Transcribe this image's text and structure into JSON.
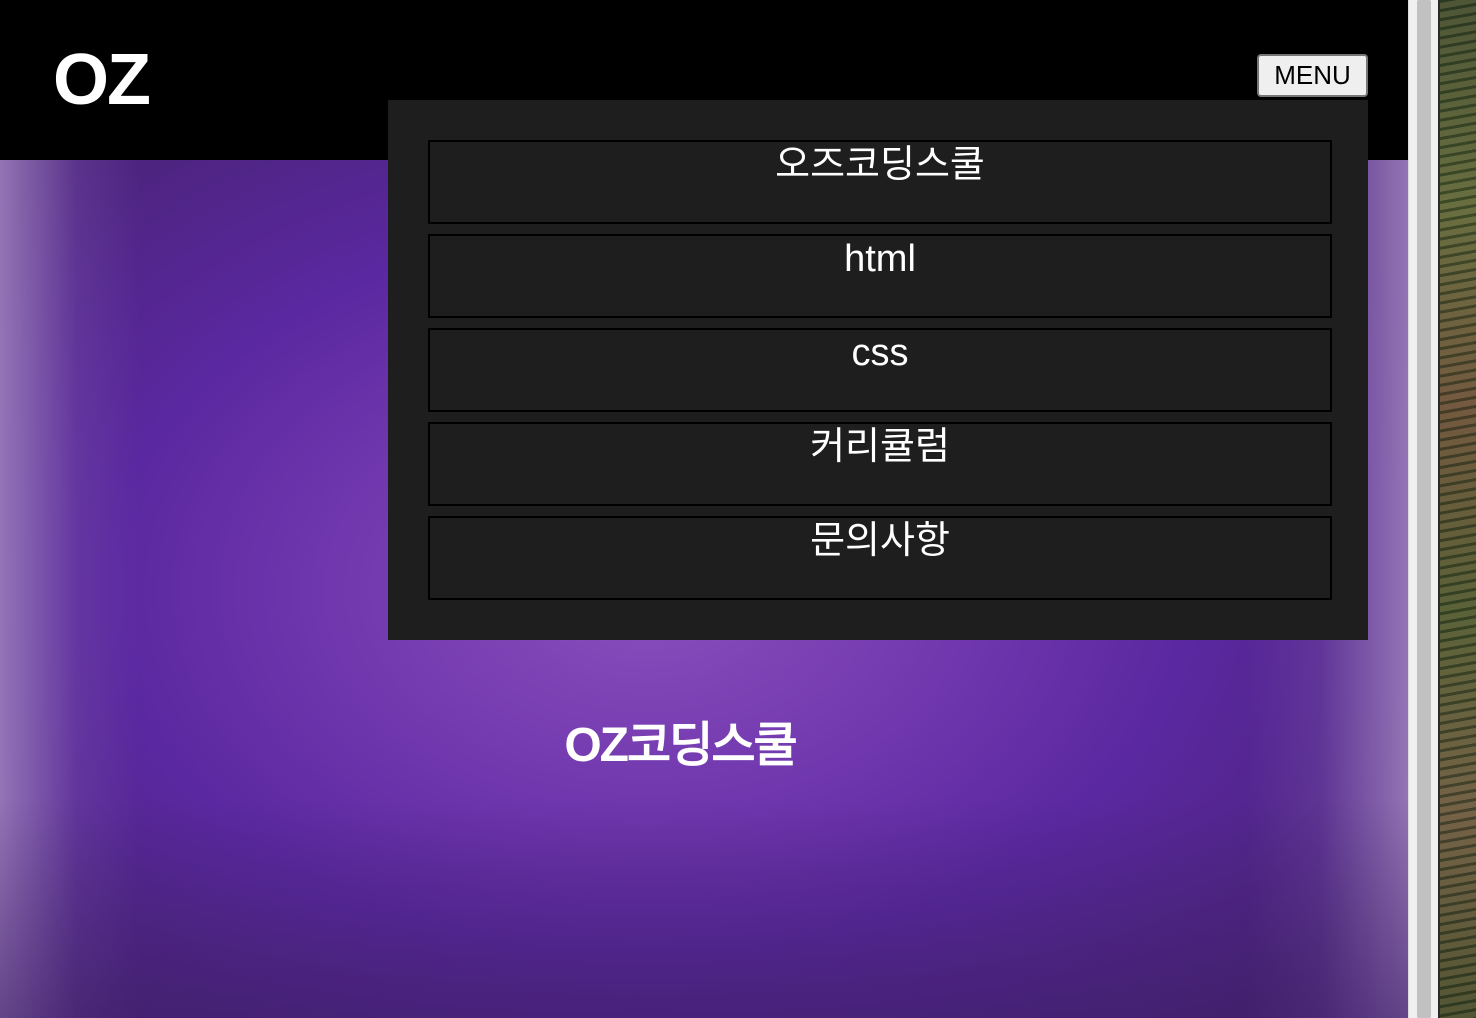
{
  "header": {
    "logo": "OZ",
    "menu_button_label": "MENU"
  },
  "menu": {
    "items": [
      {
        "label": "오즈코딩스쿨"
      },
      {
        "label": "html"
      },
      {
        "label": "css"
      },
      {
        "label": "커리큘럼"
      },
      {
        "label": "문의사항"
      }
    ]
  },
  "hero": {
    "title": "OZ코딩스쿨"
  },
  "colors": {
    "header_bg": "#000000",
    "menu_panel_bg": "#1e1e1e",
    "hero_purple": "#6f36ad",
    "text": "#ffffff"
  }
}
